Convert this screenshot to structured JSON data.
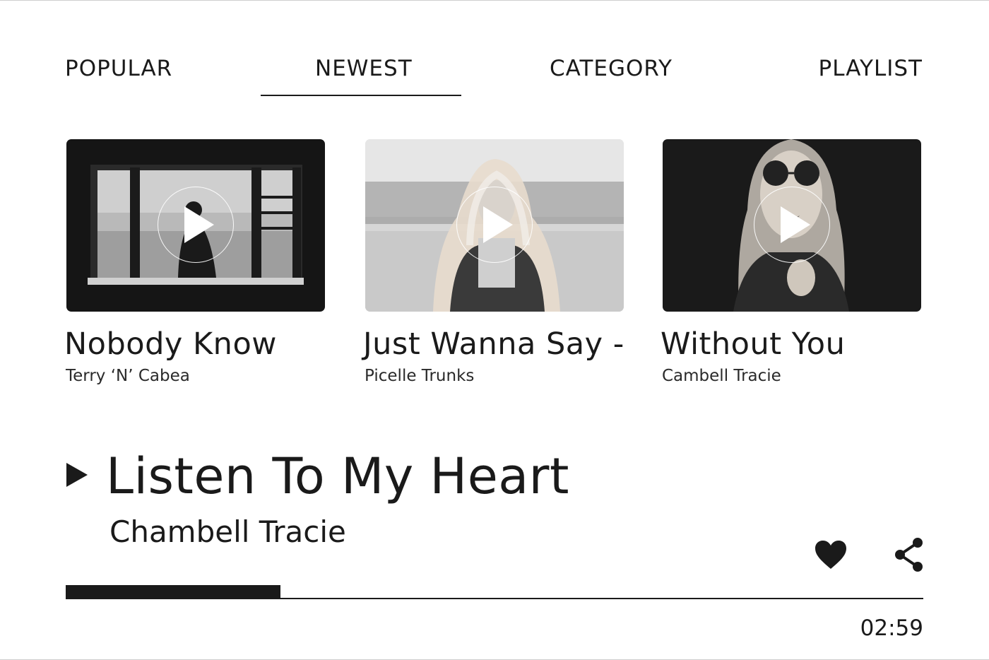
{
  "tabs": {
    "items": [
      {
        "label": "POPULAR"
      },
      {
        "label": "NEWEST"
      },
      {
        "label": "CATEGORY"
      },
      {
        "label": "PLAYLIST"
      }
    ],
    "active": "NEWEST"
  },
  "cards": [
    {
      "title": "Nobody Know",
      "artist": "Terry ‘N’ Cabea"
    },
    {
      "title": "Just Wanna Say -",
      "artist": "Picelle Trunks"
    },
    {
      "title": "Without You",
      "artist": "Cambell Tracie"
    }
  ],
  "now_playing": {
    "title": "Listen To My Heart",
    "artist": "Chambell Tracie",
    "time": "02:59",
    "progress": 0.25,
    "icons": [
      "play-icon",
      "heart-icon",
      "share-icon"
    ]
  },
  "colors": {
    "ink": "#1a1a1a",
    "background": "#ffffff"
  }
}
